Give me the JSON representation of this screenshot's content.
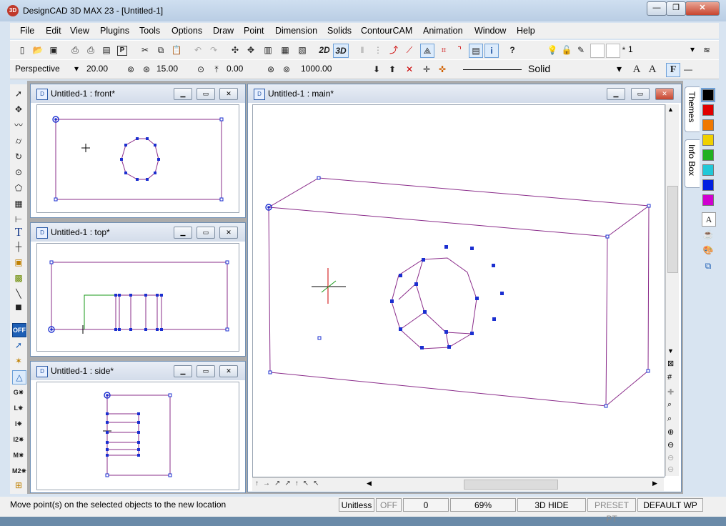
{
  "app": {
    "title": "DesignCAD 3D MAX 23 - [Untitled-1]",
    "icon_label": "3D"
  },
  "window_controls": {
    "minimize": "—",
    "maximize": "❐",
    "close": "✕"
  },
  "menu": [
    "File",
    "Edit",
    "View",
    "Plugins",
    "Tools",
    "Options",
    "Draw",
    "Point",
    "Dimension",
    "Solids",
    "ContourCAM",
    "Animation",
    "Window",
    "Help"
  ],
  "toolbar1": {
    "mode2d": "2D",
    "mode3d": "3D",
    "layer_value": "1",
    "layer_star": "*"
  },
  "toolbar2": {
    "view_select": "Perspective",
    "field1": "20.00",
    "field2": "15.00",
    "field3": "0.00",
    "field4": "1000.00",
    "line_style": "Solid",
    "text_a1": "A",
    "text_a2": "A",
    "text_f": "F"
  },
  "left_tools": {
    "off_label": "OFF",
    "text_tool": "T"
  },
  "views": {
    "front": {
      "title": "Untitled-1 : front*"
    },
    "top": {
      "title": "Untitled-1 : top*"
    },
    "side": {
      "title": "Untitled-1 : side*"
    },
    "main": {
      "title": "Untitled-1 : main*"
    }
  },
  "right_panel": {
    "tabs": [
      "Themes",
      "Info Box"
    ],
    "colors": [
      "#000000",
      "#e00000",
      "#f07800",
      "#f0d000",
      "#20b020",
      "#20c8d8",
      "#0020e0",
      "#d000d0"
    ],
    "font_icon": "A"
  },
  "status": {
    "message": "Move point(s) on the selected objects to the new location",
    "units": "Unitless",
    "snap": "OFF",
    "counter": "0",
    "zoom": "69%",
    "hide": "3D HIDE",
    "preset": "PRESET PT",
    "wp": "DEFAULT WP"
  }
}
